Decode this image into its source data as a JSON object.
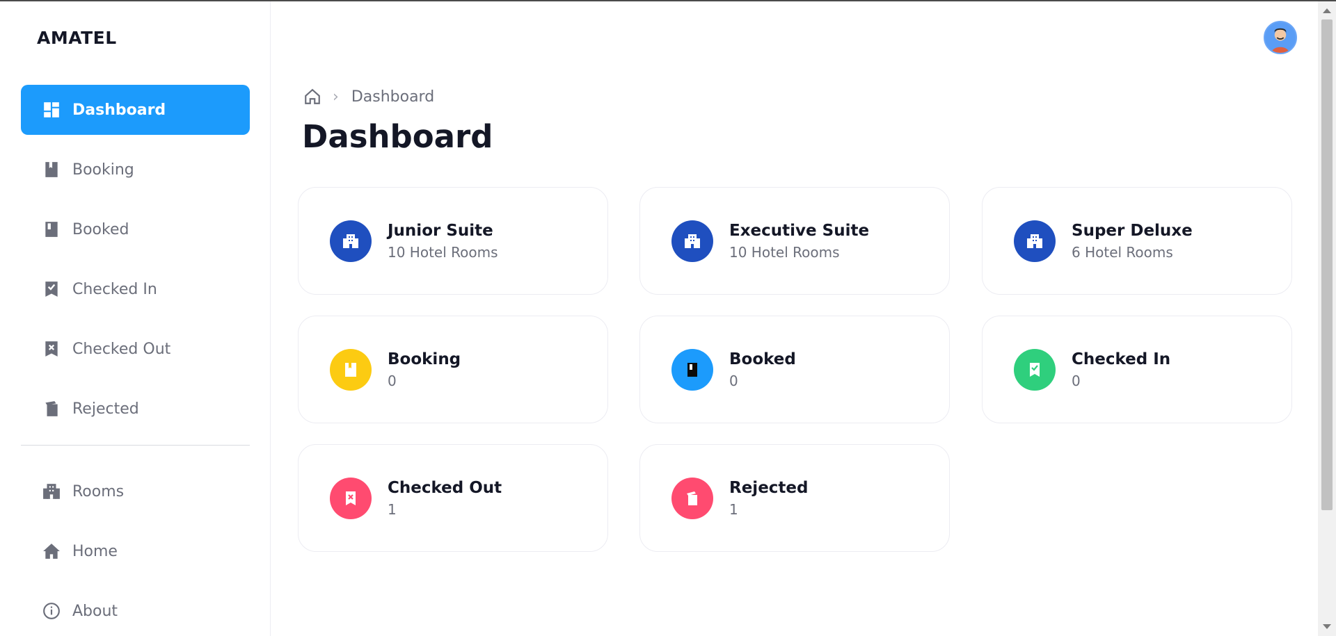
{
  "brand": "AMATEL",
  "sidebar": {
    "items": [
      {
        "label": "Dashboard",
        "icon": "dashboard-icon",
        "active": true
      },
      {
        "label": "Booking",
        "icon": "bookmark-book-icon"
      },
      {
        "label": "Booked",
        "icon": "book-icon"
      },
      {
        "label": "Checked In",
        "icon": "bookmark-check-icon"
      },
      {
        "label": "Checked Out",
        "icon": "bookmark-x-icon"
      },
      {
        "label": "Rejected",
        "icon": "rejected-doc-icon"
      }
    ],
    "items2": [
      {
        "label": "Rooms",
        "icon": "building-icon"
      },
      {
        "label": "Home",
        "icon": "home-icon"
      },
      {
        "label": "About",
        "icon": "info-icon"
      }
    ]
  },
  "breadcrumb": {
    "current": "Dashboard",
    "home_icon": "home-outline-icon"
  },
  "page_title": "Dashboard",
  "colors": {
    "accent": "#1c9bfc",
    "room": "#1f4fbf",
    "booking": "#fccb12",
    "booked": "#1c9bfc",
    "checked_in": "#2fcf7d",
    "checked_out": "#ff4b70",
    "rejected": "#ff4b70"
  },
  "cards": [
    {
      "title": "Junior Suite",
      "sub": "10 Hotel Rooms",
      "icon": "building-icon",
      "color": "room"
    },
    {
      "title": "Executive Suite",
      "sub": "10 Hotel Rooms",
      "icon": "building-icon",
      "color": "room"
    },
    {
      "title": "Super Deluxe",
      "sub": "6 Hotel Rooms",
      "icon": "building-icon",
      "color": "room"
    },
    {
      "title": "Booking",
      "sub": "0",
      "icon": "bookmark-book-icon",
      "color": "booking"
    },
    {
      "title": "Booked",
      "sub": "0",
      "icon": "book-icon",
      "color": "booked"
    },
    {
      "title": "Checked In",
      "sub": "0",
      "icon": "bookmark-check-icon",
      "color": "checked_in"
    },
    {
      "title": "Checked Out",
      "sub": "1",
      "icon": "bookmark-x-icon",
      "color": "checked_out"
    },
    {
      "title": "Rejected",
      "sub": "1",
      "icon": "rejected-doc-icon",
      "color": "rejected"
    }
  ]
}
